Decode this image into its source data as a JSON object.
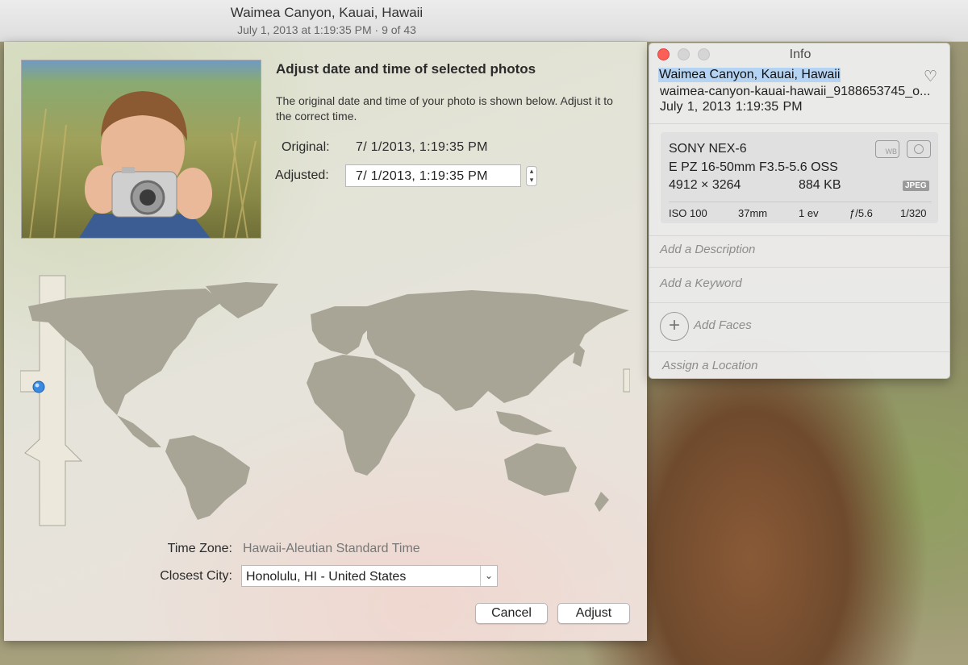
{
  "window": {
    "title": "Waimea Canyon, Kauai, Hawaii",
    "subtitle": "July 1, 2013 at 1:19:35 PM  ·  9 of 43"
  },
  "adjust_dialog": {
    "heading": "Adjust date and time of selected photos",
    "description": "The original date and time of your photo is shown below. Adjust it to the correct time.",
    "original_label": "Original:",
    "original_value": "7/  1/2013,   1:19:35 PM",
    "adjusted_label": "Adjusted:",
    "adjusted_value": "7/  1/2013,   1:19:35 PM",
    "timezone_label": "Time Zone:",
    "timezone_value": "Hawaii-Aleutian Standard Time",
    "city_label": "Closest City:",
    "city_value": "Honolulu, HI - United States",
    "cancel_label": "Cancel",
    "adjust_label": "Adjust"
  },
  "info_panel": {
    "title": "Info",
    "photo_name": "Waimea Canyon, Kauai, Hawaii",
    "filename": "waimea-canyon-kauai-hawaii_9188653745_o...",
    "date_time": "July 1, 2013   1:19:35 PM",
    "camera": "SONY NEX-6",
    "lens": "E PZ 16-50mm F3.5-5.6 OSS",
    "dimensions": "4912 × 3264",
    "file_size": "884 KB",
    "format": "JPEG",
    "wb_label": "WB",
    "iso": "ISO 100",
    "focal_length": "37mm",
    "exposure_value": "1 ev",
    "aperture": "ƒ/5.6",
    "shutter": "1/320",
    "description_placeholder": "Add a Description",
    "keyword_placeholder": "Add a Keyword",
    "faces_label": "Add Faces",
    "location_placeholder": "Assign a Location"
  },
  "colors": {
    "close": "#fc5f57",
    "inactive_traffic": "#d5d5d5",
    "selection": "#b5d3f3",
    "map_land": "#a8a596"
  }
}
